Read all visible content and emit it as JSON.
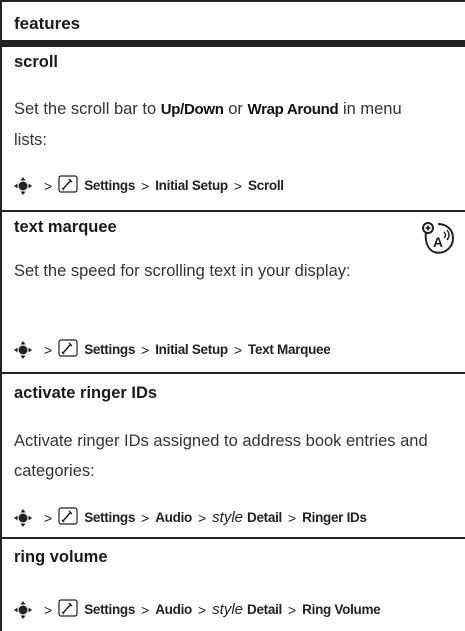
{
  "header": {
    "title": "features"
  },
  "rows": [
    {
      "title": "scroll",
      "desc_before": "Set the scroll bar to ",
      "opt1": "Up/Down",
      "desc_mid": " or ",
      "opt2": "Wrap Around",
      "desc_after": " in menu lists:",
      "path": [
        "Settings",
        "Initial Setup",
        "Scroll"
      ]
    },
    {
      "title": "text marquee",
      "desc": "Set the speed for scrolling text in your display:",
      "path": [
        "Settings",
        "Initial Setup",
        "Text Marquee"
      ],
      "icon": "network-feature-icon"
    },
    {
      "title": "activate ringer IDs",
      "desc": "Activate ringer IDs assigned to address book entries and categories:",
      "path": [
        "Settings",
        "Audio"
      ],
      "path_italic": "style",
      "path_tail": [
        "Detail",
        "Ringer IDs"
      ]
    },
    {
      "title": "ring volume",
      "path": [
        "Settings",
        "Audio"
      ],
      "path_italic": "style",
      "path_tail": [
        "Detail",
        "Ring Volume"
      ]
    }
  ],
  "separator": ">",
  "icons": {
    "nav": "nav-key-icon",
    "settings": "settings-icon"
  }
}
